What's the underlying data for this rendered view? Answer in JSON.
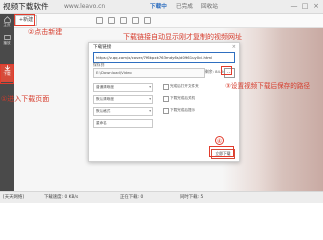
{
  "window": {
    "title": "视频下载软件",
    "site": "www.leavo.cn",
    "tabs": [
      "下载中",
      "已完成",
      "回收站"
    ],
    "controls": [
      "—",
      "□",
      "×"
    ]
  },
  "sidebar": {
    "items": [
      {
        "label": "主页",
        "icon": "home-icon"
      },
      {
        "label": "播放",
        "icon": "play-icon"
      },
      {
        "label": "下载",
        "icon": "download-icon"
      }
    ]
  },
  "toolbar": {
    "new_label": "+新建",
    "icons": [
      "play-icon",
      "pause-icon",
      "delete-icon",
      "folder-icon",
      "settings-icon"
    ]
  },
  "dialog": {
    "title": "新建下载",
    "url_label": "下载链接",
    "url_value": "https://v.qq.com/x/cover/7f6kpxk763mdy6s/d0961uy0ci.html",
    "path_label": "保存到",
    "path_value": "E:\\Download\\Video",
    "browse_label": "…",
    "selects": [
      {
        "label": "普通清晰度",
        "arrow": "▾"
      },
      {
        "label": "默认清晰度",
        "arrow": "▾"
      },
      {
        "label": "默认格式",
        "arrow": "▾"
      },
      {
        "label": "重命名",
        "arrow": ""
      }
    ],
    "checks": [
      "完成后打开文件夹",
      "下载完成后关机",
      "下载完成后提示"
    ],
    "disk_info": "剩余: 84.5G",
    "start_label": "立即下载"
  },
  "annotations": {
    "note1": "②点击新建",
    "note2": "下载链接自动显示刚才复制的视频网址",
    "note3": "③设置视频下载后保存的路径",
    "note4": "①进入下载页面",
    "circle4": "④"
  },
  "statusbar": {
    "items": [
      "[天天网络]",
      "下载速度: 0 KB/s",
      "正在下载: 0",
      "同时下载: 5"
    ]
  },
  "colors": {
    "accent_red": "#e23b2c",
    "accent_blue": "#2f6fc0",
    "sidebar": "#4a4a4a"
  }
}
